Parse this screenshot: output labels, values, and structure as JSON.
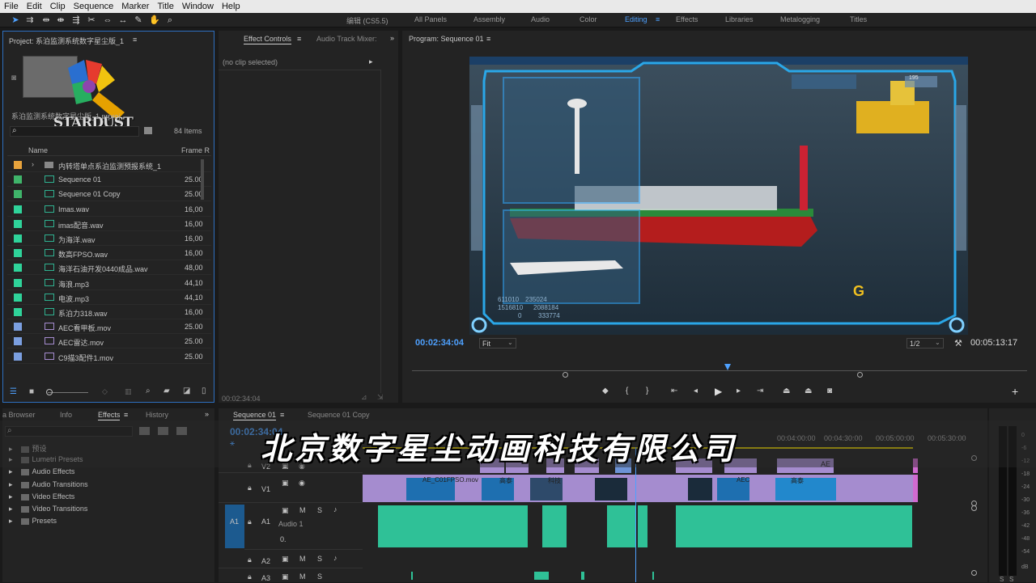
{
  "menu": [
    "File",
    "Edit",
    "Clip",
    "Sequence",
    "Marker",
    "Title",
    "Window",
    "Help"
  ],
  "workspaces": {
    "project_label": "编辑 (CS5.5)",
    "items": [
      "All Panels",
      "Assembly",
      "Audio",
      "Color",
      "Editing",
      "Effects",
      "Libraries",
      "Metalogging",
      "Titles"
    ],
    "active": "Editing"
  },
  "project": {
    "tab": "Project: 系泊监测系统数字星尘版_1",
    "file": "系泊监测系统数字星尘版_1.prproj",
    "item_count": "84 Items",
    "col_name": "Name",
    "col_frame": "Frame R",
    "logo_text": "STARDUST",
    "items": [
      {
        "name": "内转塔单点系泊监测预报系统_1",
        "frame": "",
        "color": "#e8a33c",
        "kind": "bin"
      },
      {
        "name": "Sequence 01",
        "frame": "25.00",
        "color": "#3fb46a",
        "kind": "seq"
      },
      {
        "name": "Sequence 01 Copy",
        "frame": "25.00",
        "color": "#3fb46a",
        "kind": "seq"
      },
      {
        "name": "Imas.wav",
        "frame": "16,00",
        "color": "#2fd39a",
        "kind": "audio"
      },
      {
        "name": "imas配音.wav",
        "frame": "16,00",
        "color": "#2fd39a",
        "kind": "audio"
      },
      {
        "name": "为海洋.wav",
        "frame": "16,00",
        "color": "#2fd39a",
        "kind": "audio"
      },
      {
        "name": "数高FPSO.wav",
        "frame": "16,00",
        "color": "#2fd39a",
        "kind": "audio"
      },
      {
        "name": "海洋石油开发0440成品.wav",
        "frame": "48,00",
        "color": "#2fd39a",
        "kind": "audio"
      },
      {
        "name": "海浪.mp3",
        "frame": "44,10",
        "color": "#2fd39a",
        "kind": "audio"
      },
      {
        "name": "电波.mp3",
        "frame": "44,10",
        "color": "#2fd39a",
        "kind": "audio"
      },
      {
        "name": "系泊力318.wav",
        "frame": "16,00",
        "color": "#2fd39a",
        "kind": "audio"
      },
      {
        "name": "AEC看甲板.mov",
        "frame": "25.00",
        "color": "#7b9fe0",
        "kind": "video"
      },
      {
        "name": "AEC雷达.mov",
        "frame": "25.00",
        "color": "#7b9fe0",
        "kind": "video"
      },
      {
        "name": "C9描3配件1.mov",
        "frame": "25.00",
        "color": "#7b9fe0",
        "kind": "video"
      }
    ]
  },
  "effect_controls": {
    "tab": "Effect Controls",
    "tab2": "Audio Track Mixer:",
    "no_clip": "(no clip selected)",
    "timecode": "00:02:34:04"
  },
  "program": {
    "tab": "Program: Sequence 01",
    "timecode": "00:02:34:04",
    "fit": "Fit",
    "resolution": "1/2",
    "duration": "00:05:13:17",
    "overlay_nums": [
      "611010",
      "235024",
      "1516810",
      "2088184",
      "0",
      "333774"
    ],
    "hud_value": "195",
    "badge": "G"
  },
  "effects": {
    "tabs": [
      "a Browser",
      "Info",
      "Effects",
      "History"
    ],
    "active_tab": "Effects",
    "items": [
      "预设",
      "Lumetri Presets",
      "Audio Effects",
      "Audio Transitions",
      "Video Effects",
      "Video Transitions",
      "Presets"
    ]
  },
  "timeline": {
    "tabs": [
      "Sequence 01",
      "Sequence 01 Copy"
    ],
    "timecode": "00:02:34:04",
    "ruler": [
      "00:04:00:00",
      "00:04:30:00",
      "00:05:00:00",
      "00:05:30:00"
    ],
    "tracks": {
      "v2": "V2",
      "v1": "V1",
      "a1_src": "A1",
      "a1": "A1",
      "a1_name": "Audio 1",
      "a1_vol": "0.",
      "a2": "A2",
      "a3": "A3"
    },
    "clip_labels": [
      "AE_C01FPSO.mov",
      "高泰",
      "科技",
      "AEC",
      "高泰",
      "AE"
    ]
  },
  "meter": {
    "scale": [
      "0",
      "-6",
      "-12",
      "-18",
      "-24",
      "-30",
      "-36",
      "-42",
      "-48",
      "-54",
      "dB"
    ],
    "foot": [
      "S",
      "S"
    ]
  },
  "banner": "北京数字星尘动画科技有限公司"
}
